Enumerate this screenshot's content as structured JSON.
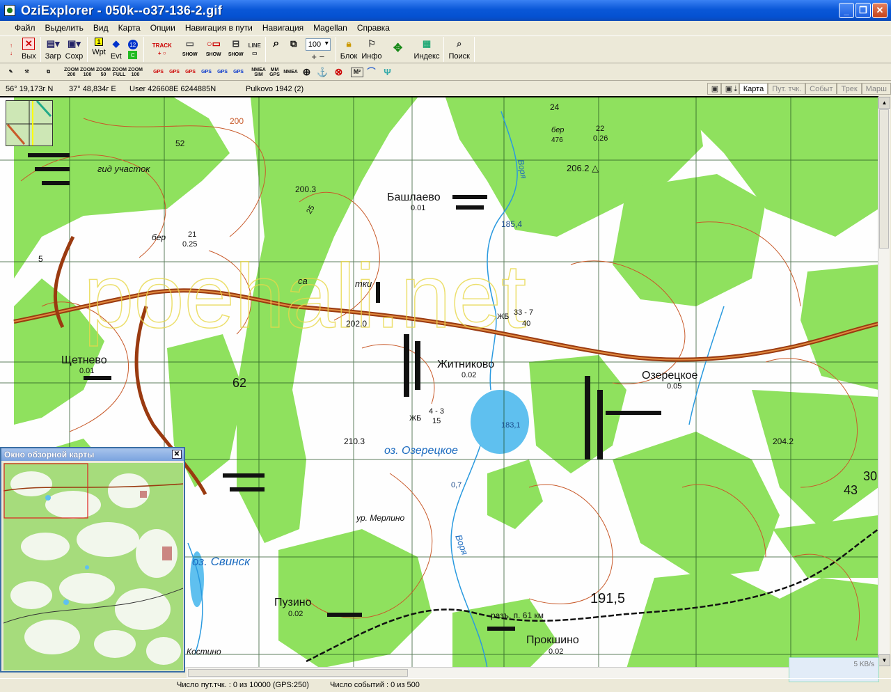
{
  "window": {
    "title": "OziExplorer - 050k--o37-136-2.gif",
    "min": "_",
    "max": "❐",
    "close": "✕"
  },
  "menu": [
    "Файл",
    "Выделить",
    "Вид",
    "Карта",
    "Опции",
    "Навигация в пути",
    "Навигация",
    "Magellan",
    "Справка"
  ],
  "toolbar": {
    "exit": "Вых",
    "load": "Загр",
    "save": "Сохр",
    "wpt": "Wpt",
    "evt": "Evt",
    "track": "TRACK",
    "show": "SHOW",
    "line": "LINE",
    "zoom_value": "100",
    "lock": "Блок",
    "info": "Инфо",
    "index": "Индекс",
    "search": "Поиск"
  },
  "toolbar2": {
    "zoom200": "ZOOM 200",
    "zoom100": "ZOOM 100",
    "zoom50": "ZOOM 50",
    "zoomfull": "ZOOM FULL",
    "zoom100b": "ZOOM 100",
    "gps": "GPS",
    "nmea_sim": "NMEA SIM",
    "mm_gps": "MM GPS",
    "nmea": "NMEA",
    "m2": "M²"
  },
  "status_top": {
    "lat": "56° 19,173г N",
    "lon": "37° 48,834г E",
    "user": "User  426608E   6244885N",
    "datum": "Pulkovo 1942 (2)"
  },
  "tabs": [
    "Карта",
    "Пут. тчк.",
    "Событ",
    "Трек",
    "Марш"
  ],
  "map_labels": {
    "bashlaevo": "Башлаево",
    "bashlaevo_n": "0.01",
    "schetnevo": "Щетнево",
    "schetnevo_n": "0.01",
    "zhitnikovo": "Житниково",
    "zhitnikovo_n": "0.02",
    "ozeretskoe": "Озерецкое",
    "ozeretskoe_n": "0.05",
    "lake": "оз. Озерецкое",
    "lake_depth": "183,1",
    "lake_d2": "0,7",
    "svinsk": "оз. Свинск",
    "puzino": "Пузино",
    "puzino_n": "0.02",
    "prokshino": "Прокшино",
    "prokshino_n": "0.02",
    "h200_3": "200.3",
    "h202_0": "202.0",
    "h206_2": "206.2 △",
    "h210_3": "210.3",
    "h204_2": "204.2",
    "h191_5": "191,5",
    "river": "Воря",
    "river2": "Воря",
    "r185": "185,4",
    "gid": "гид участок",
    "ber": "бер",
    "ber21": "21",
    "ber025": "0.25",
    "bridge": "ЖБ",
    "bridge_n": "33 - 7",
    "bridge_n2": "40",
    "zhb2": "ЖБ",
    "zhb2_n": "4 - 3",
    "zhb2_n2": "15",
    "rail": "разъ. п. 61 км",
    "merlino": "ур. Мерлино",
    "kostino": "Костино",
    "n62": "62",
    "n52": "52",
    "n200": "200",
    "n24": "24",
    "n43": "43",
    "n30": "30",
    "n5": "5",
    "n25": "25",
    "sa": "са",
    "tki": "тки",
    "ber2": "бер",
    "ber2a": "22",
    "ber2b": "0.26",
    "ber2h": "476",
    "watermark": "poehali.net"
  },
  "overview": {
    "title": "Окно обзорной карты",
    "close": "✕"
  },
  "kb": "5 KB/s",
  "status_bottom": {
    "waypoints": "Число пут.тчк. : 0 из 10000  (GPS:250)",
    "events": "Число событий : 0 из 500"
  }
}
